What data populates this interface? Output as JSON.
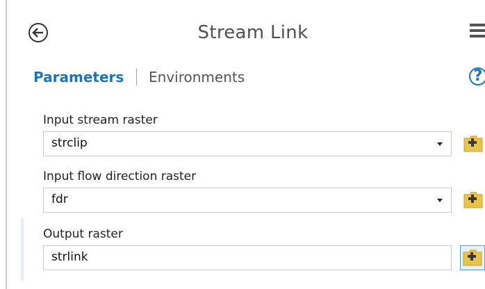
{
  "header": {
    "title": "Stream Link",
    "back_icon": "back-arrow-icon",
    "menu_icon": "hamburger-menu-icon"
  },
  "tabs": {
    "parameters_label": "Parameters",
    "environments_label": "Environments",
    "help_icon": "help-icon"
  },
  "params": [
    {
      "label": "Input stream raster",
      "value": "strclip",
      "has_dropdown": true
    },
    {
      "label": "Input flow direction raster",
      "value": "fdr",
      "has_dropdown": true
    },
    {
      "label": "Output raster",
      "value": "strlink",
      "has_dropdown": false
    }
  ],
  "colors": {
    "accent": "#1a75bb",
    "folder": "#e8c44a",
    "plus": "#3a3a3a"
  }
}
